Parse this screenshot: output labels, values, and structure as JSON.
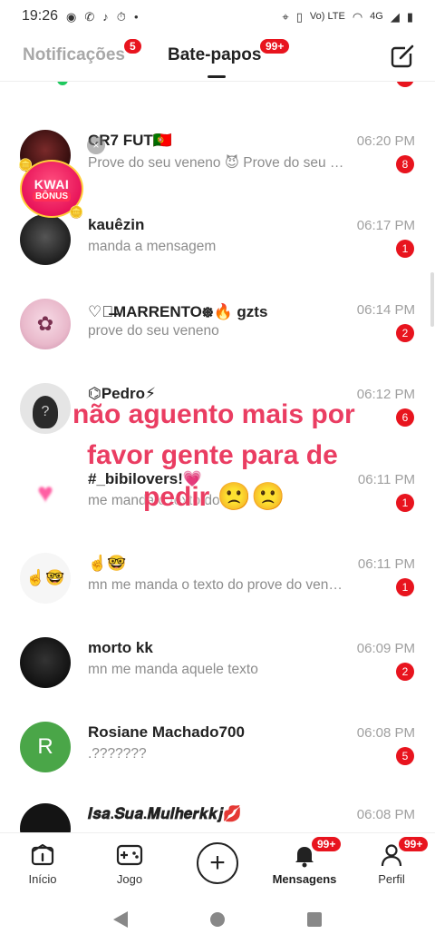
{
  "status_bar": {
    "time": "19:26",
    "left_icons": [
      "record-icon",
      "whatsapp-icon",
      "tiktok-icon",
      "timer-icon",
      "dot-icon"
    ],
    "network_label": "Vo) LTE",
    "signal_label": "4G"
  },
  "header": {
    "tabs": [
      {
        "label": "Notificações",
        "badge": "5",
        "active": false
      },
      {
        "label": "Bate-papos",
        "badge": "99+",
        "active": true
      }
    ],
    "compose_icon": "compose-icon"
  },
  "kwai": {
    "title": "KWAI",
    "subtitle": "BÔNUS",
    "close": "×"
  },
  "chats": [
    {
      "name": "CR7 FUT🇵🇹",
      "preview": "Prove do seu veneno 😈 Prove do seu veneno",
      "time": "06:20 PM",
      "unread": "8",
      "avatar": ""
    },
    {
      "name": "kauêzin",
      "preview": "manda a mensagem",
      "time": "06:17 PM",
      "unread": "1",
      "avatar": ""
    },
    {
      "name": "♡᪥̶MARRENTO᪥🔥 gzts",
      "preview": "prove do seu veneno",
      "time": "06:14 PM",
      "unread": "2",
      "avatar": "✿"
    },
    {
      "name": "⌬Pedro⚡",
      "preview": "",
      "time": "06:12 PM",
      "unread": "6",
      "avatar": "?"
    },
    {
      "name": "#_bibilovers!💗",
      "preview": "me manda o texto do pro",
      "time": "06:11 PM",
      "unread": "1",
      "avatar": "♥"
    },
    {
      "name": "☝️🤓",
      "preview": "mn me manda o texto do prove do veneno",
      "time": "06:11 PM",
      "unread": "1",
      "avatar": "☝️🤓"
    },
    {
      "name": "morto kk",
      "preview": "mn me manda aquele texto",
      "time": "06:09 PM",
      "unread": "2",
      "avatar": ""
    },
    {
      "name": "Rosiane Machado700",
      "preview": ".???????",
      "time": "06:08 PM",
      "unread": "5",
      "avatar": "R"
    },
    {
      "name": "𝑰𝒔𝒂.𝑺𝒖𝒂.𝑴𝒖𝒍𝒉𝒆𝒓𝒌𝒌𝒋💋",
      "preview": "",
      "time": "06:08 PM",
      "unread": "",
      "avatar": ""
    }
  ],
  "overlay_text": [
    "não aguento mais por",
    "favor gente para de",
    "pedir 🙁🙁"
  ],
  "bottom_nav": {
    "items": [
      {
        "label": "Início",
        "icon": "home-icon"
      },
      {
        "label": "Jogo",
        "icon": "gamepad-icon"
      },
      {
        "label": "",
        "icon": "plus-icon"
      },
      {
        "label": "Mensagens",
        "icon": "bell-icon",
        "badge": "99+"
      },
      {
        "label": "Perfil",
        "icon": "profile-icon",
        "badge": "99+"
      }
    ],
    "plus_symbol": "+"
  },
  "colors": {
    "accent_red": "#e8141e",
    "overlay_pink": "#ea3d62",
    "online_green": "#1fc95e",
    "rosiane_green": "#4aa648"
  }
}
